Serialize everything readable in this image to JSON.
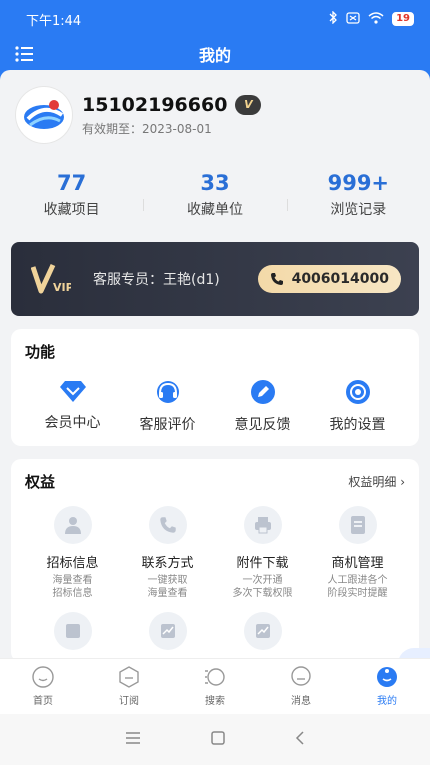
{
  "status_bar": {
    "time": "下午1:44",
    "battery": "19"
  },
  "navbar": {
    "title": "我的"
  },
  "profile": {
    "phone": "15102196660",
    "badge": "V",
    "expire": "有效期至：2023-08-01"
  },
  "stats": [
    {
      "value": "77",
      "label": "收藏项目"
    },
    {
      "value": "33",
      "label": "收藏单位"
    },
    {
      "value": "999+",
      "label": "浏览记录"
    }
  ],
  "vip": {
    "logo_text": "VIP",
    "agent": "客服专员：王艳(d1)",
    "phone": "4006014000"
  },
  "functions": {
    "title": "功能",
    "items": [
      {
        "label": "会员中心",
        "icon": "diamond-icon"
      },
      {
        "label": "客服评价",
        "icon": "headset-icon"
      },
      {
        "label": "意见反馈",
        "icon": "pen-icon"
      },
      {
        "label": "我的设置",
        "icon": "settings-icon"
      }
    ]
  },
  "rights": {
    "title": "权益",
    "more": "权益明细",
    "items": [
      {
        "name": "招标信息",
        "desc1": "海量查看",
        "desc2": "招标信息",
        "icon": "person-icon"
      },
      {
        "name": "联系方式",
        "desc1": "一键获取",
        "desc2": "海量查看",
        "icon": "phone-icon"
      },
      {
        "name": "附件下载",
        "desc1": "一次开通",
        "desc2": "多次下载权限",
        "icon": "printer-icon"
      },
      {
        "name": "商机管理",
        "desc1": "人工跟进各个",
        "desc2": "阶段实时提醒",
        "icon": "document-icon"
      }
    ]
  },
  "tabbar": [
    {
      "label": "首页",
      "icon": "home-icon"
    },
    {
      "label": "订阅",
      "icon": "subscribe-icon"
    },
    {
      "label": "搜索",
      "icon": "search-icon"
    },
    {
      "label": "消息",
      "icon": "message-icon"
    },
    {
      "label": "我的",
      "icon": "profile-icon",
      "active": true
    }
  ],
  "colors": {
    "primary": "#2a7bf3",
    "vip_bg": "#2a2e3b",
    "vip_gold": "#f3d9a8"
  }
}
